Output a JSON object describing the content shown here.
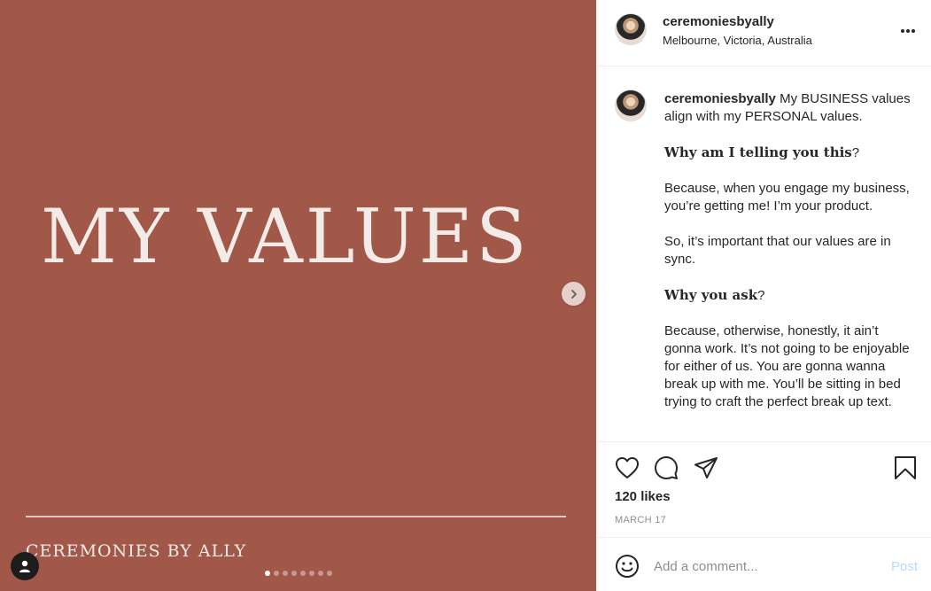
{
  "media": {
    "title": "MY VALUES",
    "brand": "CEREMONIES BY ALLY",
    "background_color": "#a15849",
    "slide_count": 8,
    "active_slide": 1,
    "next_icon": "chevron-right-icon",
    "user_tag_icon": "user-icon"
  },
  "header": {
    "username": "ceremoniesbyally",
    "location": "Melbourne, Victoria, Australia",
    "more_label": "•••"
  },
  "caption": {
    "username": "ceremoniesbyally",
    "text": " My BUSINESS values align with my PERSONAL values.",
    "paragraphs": [
      {
        "bold": "Why am I telling you this",
        "rest": "?"
      },
      {
        "text": "Because, when you engage my business, you’re getting me! I’m your product."
      },
      {
        "text": "So, it’s important that our values are in sync."
      },
      {
        "bold": "Why you ask",
        "rest": "?"
      },
      {
        "text": "Because, otherwise, honestly, it ain’t gonna work. It’s not going to be enjoyable for either of us. You are gonna wanna break up with me. You’ll be sitting in bed trying to craft the perfect break up text."
      }
    ]
  },
  "actions": {
    "icons": [
      "heart-icon",
      "comment-icon",
      "share-icon",
      "bookmark-icon"
    ],
    "likes": "120 likes",
    "date": "MARCH 17"
  },
  "comment_box": {
    "placeholder": "Add a comment...",
    "post_label": "Post",
    "emoji_icon": "emoji-icon"
  }
}
